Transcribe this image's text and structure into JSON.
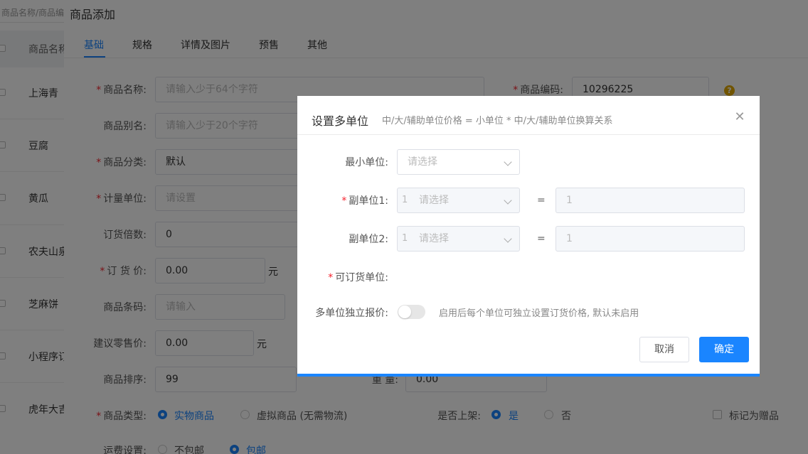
{
  "list": {
    "search_placeholder": "商品名称/商品编码",
    "header": "商品名称",
    "items": [
      "上海青",
      "豆腐",
      "黄瓜",
      "农夫山泉",
      "芝麻饼",
      "小程序订",
      "虎年大吉"
    ]
  },
  "panel": {
    "title": "商品添加",
    "tabs": [
      "基础",
      "规格",
      "详情及图片",
      "预售",
      "其他"
    ],
    "fields": {
      "name_label": "商品名称:",
      "name_placeholder": "请输入少于64个字符",
      "code_label": "商品编码:",
      "code_value": "10296225",
      "alias_label": "商品别名:",
      "alias_placeholder": "请输入少于20个字符",
      "category_label": "商品分类:",
      "category_value": "默认",
      "unit_label": "计量单位:",
      "unit_placeholder": "请设置",
      "multiple_label": "订货倍数:",
      "multiple_value": "0",
      "price_label": "订 货 价:",
      "price_value": "0.00",
      "yuan": "元",
      "barcode_label": "商品条码:",
      "barcode_placeholder": "请输入",
      "retail_label": "建议零售价:",
      "retail_value": "0.00",
      "sort_label": "商品排序:",
      "sort_value": "99",
      "weight_label": "重 量:",
      "weight_value": "0.00",
      "type_label": "商品类型:",
      "type_physical": "实物商品",
      "type_virtual": "虚拟商品 (无需物流)",
      "shelf_label": "是否上架:",
      "shelf_yes": "是",
      "shelf_no": "否",
      "gift_label": "标记为赠品",
      "shipping_label": "运费设置:",
      "shipping_no_free": "不包邮",
      "shipping_free": "包邮"
    },
    "help_icon": "?"
  },
  "dialog": {
    "title": "设置多单位",
    "subtitle": "中/大/辅助单位价格 = 小单位 * 中/大/辅助单位换算关系",
    "close": "✕",
    "min_unit_label": "最小单位:",
    "select_placeholder": "请选择",
    "sub_unit1_label": "副单位1:",
    "sub_unit2_label": "副单位2:",
    "prefix_num": "1",
    "equals": "=",
    "ratio_value": "1",
    "orderable_label": "可订货单位:",
    "independent_label": "多单位独立报价:",
    "independent_hint": "启用后每个单位可独立设置订货价格, 默认未启用",
    "cancel": "取消",
    "confirm": "确定"
  },
  "colors": {
    "accent": "#1a85ff",
    "required": "#f5222d",
    "help": "#e0a800"
  }
}
